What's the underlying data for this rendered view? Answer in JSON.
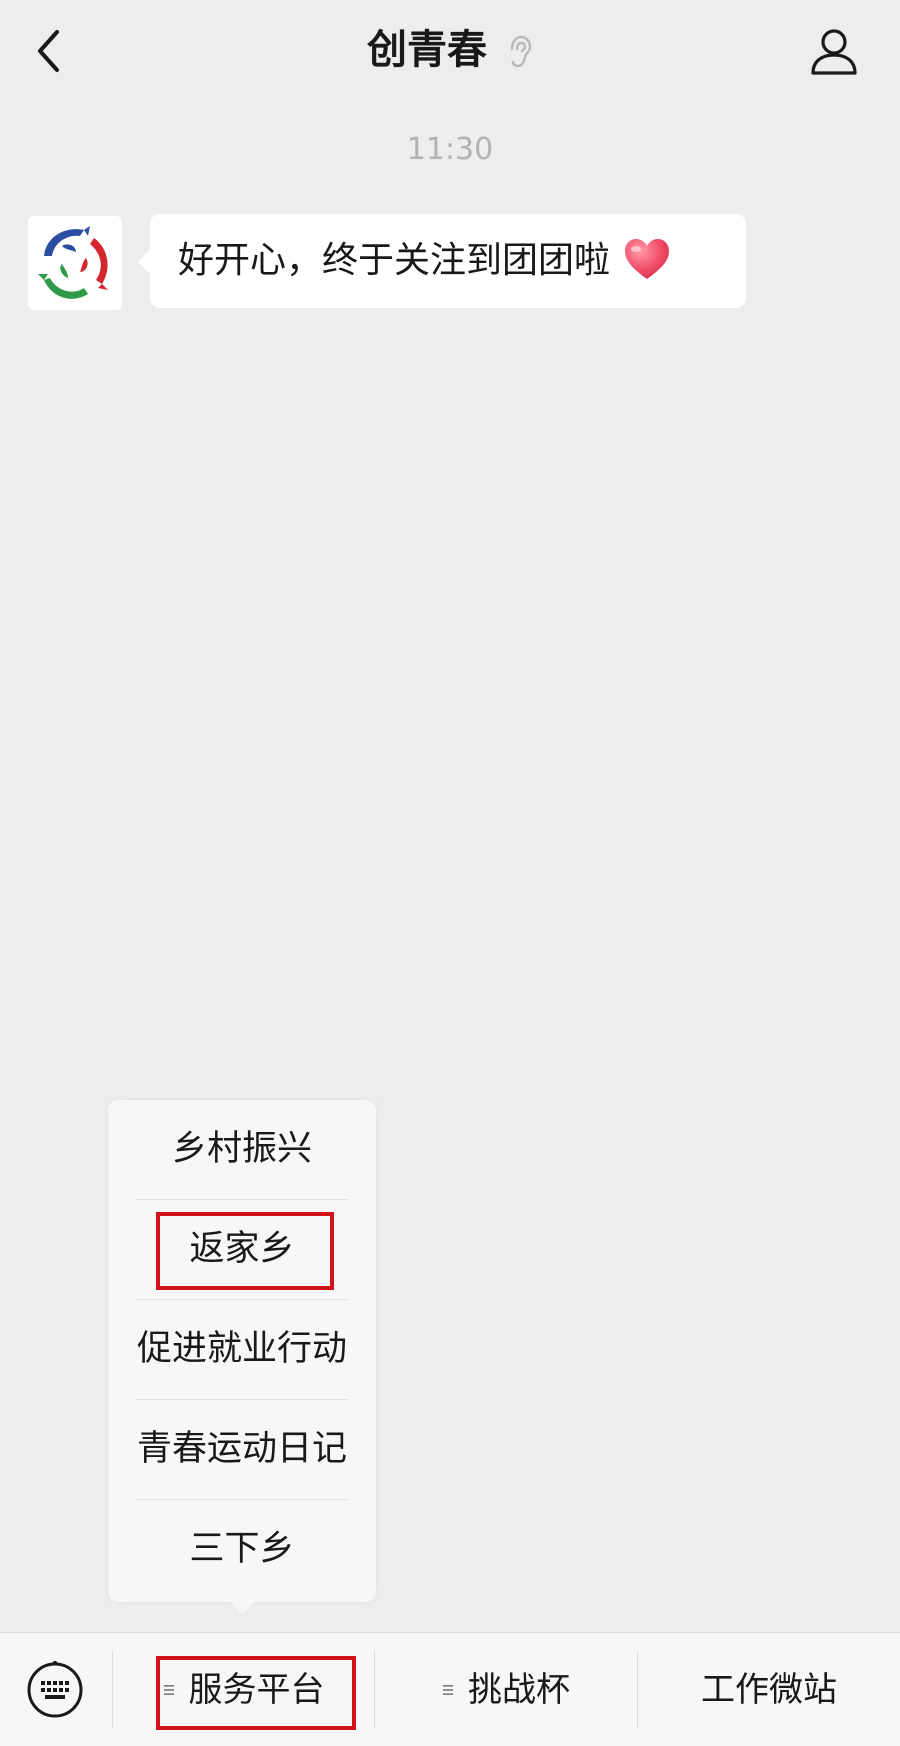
{
  "header": {
    "title": "创青春",
    "back_icon": "chevron-left-icon",
    "ear_icon": "ear-icon",
    "profile_icon": "person-icon"
  },
  "chat": {
    "timestamp": "11:30",
    "messages": [
      {
        "text": "好开心，终于关注到团团啦",
        "emoji": "heart-icon"
      }
    ]
  },
  "popup_menu": {
    "items": [
      {
        "label": "乡村振兴"
      },
      {
        "label": "返家乡"
      },
      {
        "label": "促进就业行动"
      },
      {
        "label": "青春运动日记"
      },
      {
        "label": "三下乡"
      }
    ]
  },
  "menubar": {
    "keyboard_icon": "keyboard-icon",
    "items": [
      {
        "label": "服务平台"
      },
      {
        "label": "挑战杯"
      },
      {
        "label": "工作微站"
      }
    ]
  },
  "colors": {
    "background": "#ededed",
    "highlight": "#d0121b",
    "bubble": "#ffffff"
  }
}
